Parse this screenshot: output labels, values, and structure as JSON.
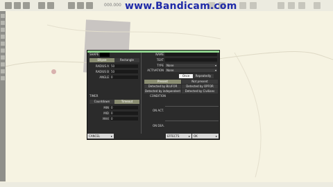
{
  "watermark": "www.Bandicam.com",
  "toolbar": {
    "zoom_value": "000.000"
  },
  "dialog": {
    "shape_label": "SHAPE",
    "shape_options": [
      "Ellipse",
      "Rectangle"
    ],
    "shape_selected": "Ellipse",
    "radius_a": {
      "label": "RADIUS A",
      "value": "50"
    },
    "radius_b": {
      "label": "RADIUS B",
      "value": "50"
    },
    "angle": {
      "label": "ANGLE",
      "value": "0"
    },
    "timer_label": "TIMER",
    "timer_options": [
      "Countdown",
      "Timeout"
    ],
    "timer_selected": "Timeout",
    "min": {
      "label": "MIN",
      "value": "0"
    },
    "mid": {
      "label": "MID",
      "value": "0"
    },
    "max": {
      "label": "MAX",
      "value": "0"
    },
    "name_label": "NAME",
    "text_label": "TEXT",
    "type": {
      "label": "TYPE",
      "value": "None"
    },
    "activation": {
      "label": "ACTIVATION",
      "value": "None"
    },
    "repeat_options": [
      "Once",
      "Repeatedly"
    ],
    "repeat_selected": "Once",
    "presence_options": [
      "Present",
      "Not present",
      "Detected by BLUFOR",
      "Detected by OPFOR",
      "Detected by independent",
      "Detected by Civilians"
    ],
    "presence_selected": "Present",
    "condition_label": "CONDITION",
    "on_act_label": "ON ACT.",
    "on_dea_label": "ON DEA.",
    "cancel_label": "CANCEL",
    "effects_label": "EFFECTS",
    "ok_label": "OK"
  },
  "colors": {
    "accent_bar": "#8fd38d",
    "dialog_bg": "#2b2b2b",
    "map_bg": "#f6f3e2"
  }
}
